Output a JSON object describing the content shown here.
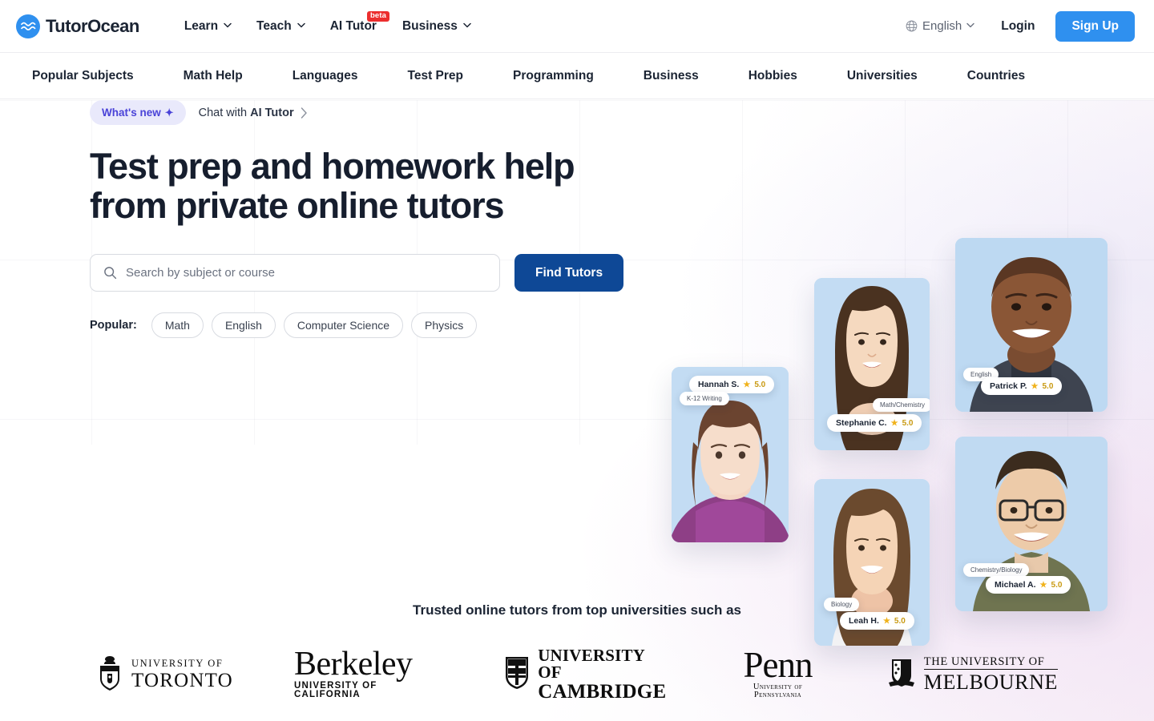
{
  "brand": {
    "name": "TutorOcean",
    "logo_icon": "wave-circle-logo",
    "accent": "#2f90ef"
  },
  "header": {
    "nav": [
      {
        "label": "Learn",
        "has_caret": true,
        "badge": null
      },
      {
        "label": "Teach",
        "has_caret": true,
        "badge": null
      },
      {
        "label": "AI Tutor",
        "has_caret": false,
        "badge": "beta"
      },
      {
        "label": "Business",
        "has_caret": true,
        "badge": null
      }
    ],
    "language": {
      "label": "English",
      "icon": "globe-icon"
    },
    "login_label": "Login",
    "signup_label": "Sign Up"
  },
  "subnav": {
    "items": [
      "Popular Subjects",
      "Math Help",
      "Languages",
      "Test Prep",
      "Programming",
      "Business",
      "Hobbies",
      "Universities",
      "Countries"
    ]
  },
  "hero": {
    "whats_new_label": "What's new",
    "whats_new_icon": "sparkle-icon",
    "chat_link_prefix": "Chat with ",
    "chat_link_strong": "AI Tutor",
    "chat_link_icon": "chevron-right-icon",
    "headline_line1": "Test prep and homework help",
    "headline_line2": "from private online tutors",
    "search": {
      "placeholder": "Search by subject or course",
      "value": "",
      "icon": "search-icon",
      "button_label": "Find Tutors",
      "button_color": "#0e4896"
    },
    "popular_label": "Popular:",
    "popular_tags": [
      "Math",
      "English",
      "Computer Science",
      "Physics"
    ]
  },
  "tutors": [
    {
      "id": "hannah",
      "name": "Hannah S.",
      "subject": "K-12 Writing",
      "rating": "5.0"
    },
    {
      "id": "stephanie",
      "name": "Stephanie C.",
      "subject": "Math/Chemistry",
      "rating": "5.0"
    },
    {
      "id": "patrick",
      "name": "Patrick P.",
      "subject": "English",
      "rating": "5.0"
    },
    {
      "id": "leah",
      "name": "Leah H.",
      "subject": "Biology",
      "rating": "5.0"
    },
    {
      "id": "michael",
      "name": "Michael A.",
      "subject": "Chemistry/Biology",
      "rating": "5.0"
    }
  ],
  "trusted": {
    "title": "Trusted online tutors from top universities such as",
    "universities": [
      {
        "id": "toronto",
        "line1": "UNIVERSITY OF",
        "line2": "TORONTO",
        "crest": "toronto-crest-icon"
      },
      {
        "id": "berkeley",
        "line1": "Berkeley",
        "line2": "UNIVERSITY OF CALIFORNIA",
        "crest": null
      },
      {
        "id": "cambridge",
        "line1": "UNIVERSITY OF",
        "line2": "CAMBRIDGE",
        "crest": "cambridge-crest-icon"
      },
      {
        "id": "penn",
        "line1": "Penn",
        "line2": "University of Pennsylvania",
        "crest": null
      },
      {
        "id": "melbourne",
        "line1": "THE UNIVERSITY OF",
        "line2": "MELBOURNE",
        "crest": "melbourne-crest-icon"
      }
    ]
  }
}
